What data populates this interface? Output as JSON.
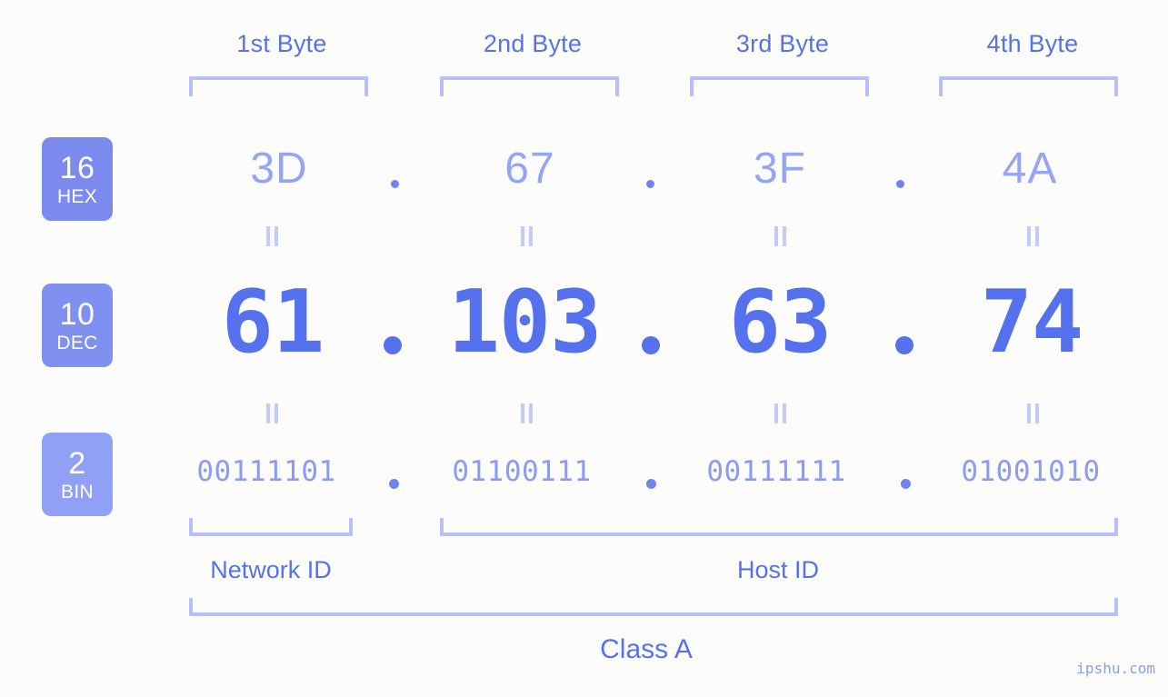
{
  "byte_headers": [
    {
      "label": "1st Byte"
    },
    {
      "label": "2nd Byte"
    },
    {
      "label": "3rd Byte"
    },
    {
      "label": "4th Byte"
    }
  ],
  "bases": [
    {
      "number": "16",
      "abbr": "HEX",
      "color": "#7b8aec"
    },
    {
      "number": "10",
      "abbr": "DEC",
      "color": "#8090f0"
    },
    {
      "number": "2",
      "abbr": "BIN",
      "color": "#8fa0f5"
    }
  ],
  "rows": {
    "hex": {
      "values": [
        "3D",
        "67",
        "3F",
        "4A"
      ],
      "separator": "."
    },
    "dec": {
      "values": [
        "61",
        "103",
        "63",
        "74"
      ],
      "separator": "."
    },
    "bin": {
      "values": [
        "00111101",
        "01100111",
        "00111111",
        "01001010"
      ],
      "separator": "."
    }
  },
  "equivalence_mark": "=",
  "segments": [
    {
      "label": "Network ID"
    },
    {
      "label": "Host ID"
    }
  ],
  "class": {
    "label": "Class A"
  },
  "watermark": {
    "text": "ipshu.com"
  },
  "colors": {
    "background": "#fcfdfa",
    "accent": "#5671ee",
    "accent_light": "#96a4f4",
    "bracket": "#b6c0fb"
  }
}
